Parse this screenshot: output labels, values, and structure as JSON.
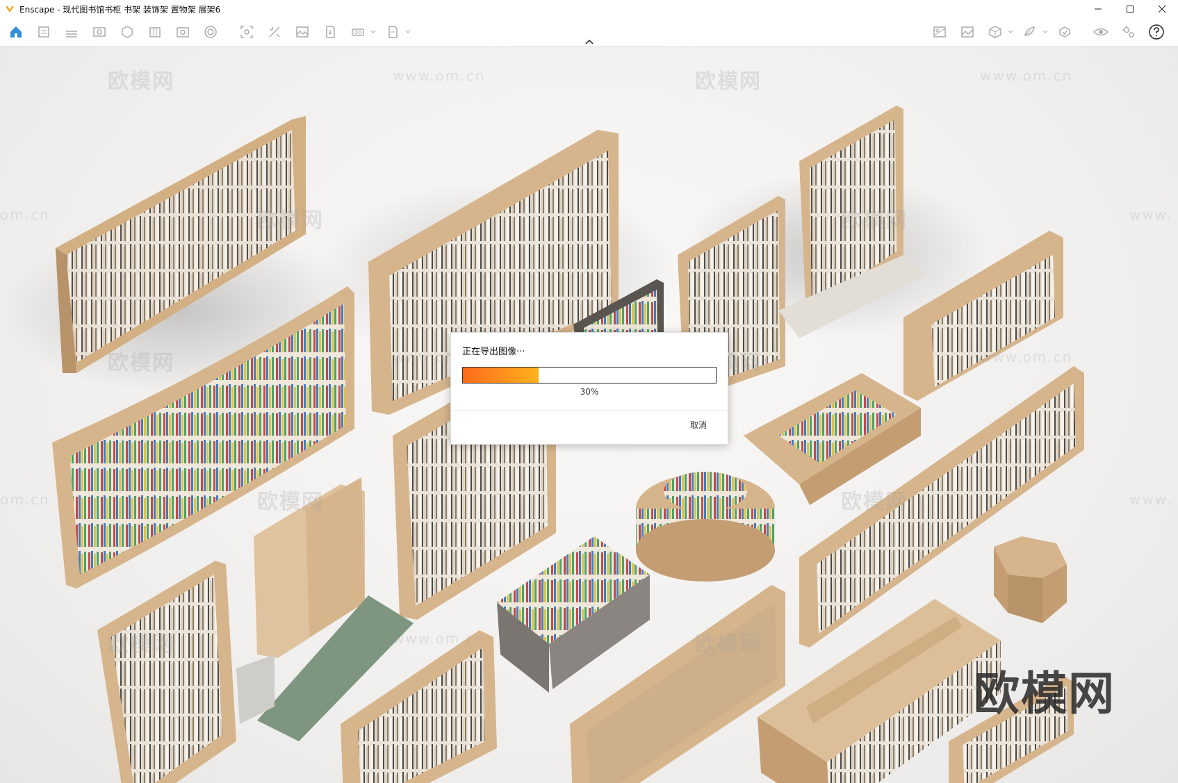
{
  "window": {
    "title": "Enscape - 现代图书馆书柜 书架 装饰架 置物架 展架6"
  },
  "toolbar": {
    "left_icons": [
      "home-icon",
      "assets-icon",
      "bim-icon",
      "view-icon",
      "material-icon",
      "library-icon",
      "video-icon",
      "panorama-icon",
      "screenshot-icon",
      "batch-icon",
      "image-icon",
      "export-icon",
      "vr-icon",
      "exe-icon"
    ],
    "right_icons": [
      "atmosphere-icon",
      "image-settings-icon",
      "capture-icon",
      "sun-icon",
      "sync-icon",
      "eye-icon",
      "settings-icon",
      "help-icon"
    ]
  },
  "dialog": {
    "title": "正在导出图像···",
    "progress": 0.3,
    "progress_label": "30%",
    "cancel_label": "取消"
  },
  "watermarks": {
    "brand": "欧模网",
    "site": "www.om.cn",
    "site_short": "om.cn",
    "site_prefix": "www."
  },
  "colors": {
    "progress_start": "#ff6a1a",
    "progress_end": "#ffb21f",
    "wood": "#d6b48c",
    "accent": "#2f8fd6"
  }
}
